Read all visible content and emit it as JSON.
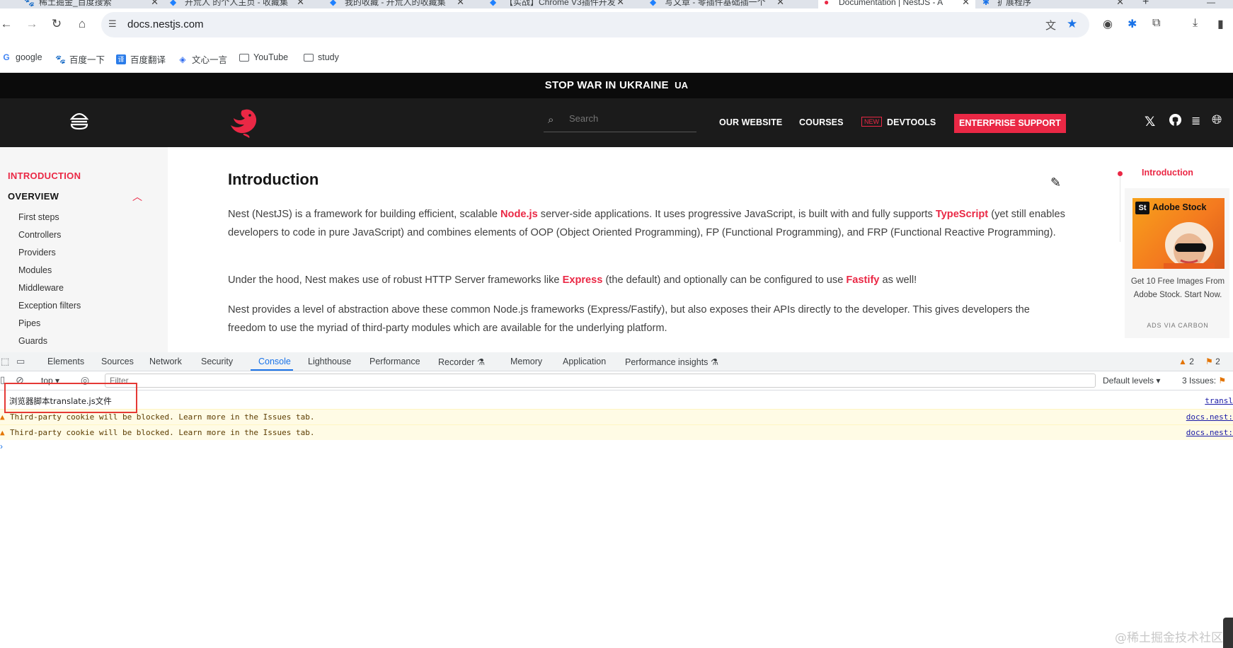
{
  "browser": {
    "tabs": [
      {
        "title": "稀土掘金_百度搜索"
      },
      {
        "title": "开荒人 的个人主页 - 收藏集"
      },
      {
        "title": "我的收藏 - 开荒人的收藏集"
      },
      {
        "title": "【实战】Chrome V3插件开发"
      },
      {
        "title": "写文章 - 零插件基础插一个"
      },
      {
        "title": "Documentation | NestJS - A"
      },
      {
        "title": "扩展程序"
      }
    ],
    "new_tab": "+",
    "url": "docs.nestjs.com",
    "bookmarks": [
      "google",
      "百度一下",
      "百度翻译",
      "文心一言",
      "YouTube",
      "study"
    ]
  },
  "banner": {
    "text": "STOP WAR IN UKRAINE",
    "badge": "UA"
  },
  "nav": {
    "search_placeholder": "Search",
    "links": [
      "OUR WEBSITE",
      "COURSES",
      "DEVTOOLS"
    ],
    "new_badge": "NEW",
    "enterprise": "ENTERPRISE SUPPORT"
  },
  "sidebar": {
    "intro": "INTRODUCTION",
    "overview": "OVERVIEW",
    "items": [
      "First steps",
      "Controllers",
      "Providers",
      "Modules",
      "Middleware",
      "Exception filters",
      "Pipes",
      "Guards"
    ]
  },
  "content": {
    "title": "Introduction",
    "p1": [
      "Nest (NestJS) is a framework for building efficient, scalable ",
      "Node.js",
      " server-side applications. It uses progressive JavaScript, is built with and fully supports ",
      "TypeScript",
      " (yet still enables developers to code in pure JavaScript) and combines elements of OOP (Object Oriented Programming), FP (Functional Programming), and FRP (Functional Reactive Programming)."
    ],
    "p2": [
      "Under the hood, Nest makes use of robust HTTP Server frameworks like ",
      "Express",
      " (the default) and optionally can be configured to use ",
      "Fastify",
      " as well!"
    ],
    "p3": "Nest provides a level of abstraction above these common Node.js frameworks (Express/Fastify), but also exposes their APIs directly to the developer. This gives developers the freedom to use the myriad of third-party modules which are available for the underlying platform."
  },
  "toc": {
    "active": "Introduction"
  },
  "ad": {
    "brand": "Adobe Stock",
    "logo": "St",
    "text": "Get 10 Free Images From Adobe Stock. Start Now.",
    "via": "ADS VIA CARBON"
  },
  "devtools": {
    "tabs": [
      "Elements",
      "Sources",
      "Network",
      "Security",
      "Console",
      "Lighthouse",
      "Performance",
      "Recorder ⚗",
      "Memory",
      "Application",
      "Performance insights ⚗"
    ],
    "active_tab": "Console",
    "warnings_count": "2",
    "issues_badge": "2",
    "context": "top",
    "filter_placeholder": "Filter",
    "levels": "Default levels",
    "issues_label": "3 Issues:",
    "issues_count": "3",
    "log": {
      "text": "浏览器脚本translate.js文件",
      "source": "transl"
    },
    "warnings": [
      {
        "text": "Third-party cookie will be blocked. Learn more in the Issues tab.",
        "source": "docs.nest:"
      },
      {
        "text": "Third-party cookie will be blocked. Learn more in the Issues tab.",
        "source": "docs.nest:"
      }
    ]
  },
  "watermark": "@稀土掘金技术社区",
  "colors": {
    "accent": "#ea2845",
    "devtools_blue": "#1a73e8",
    "warn_bg": "#fffbe5"
  }
}
